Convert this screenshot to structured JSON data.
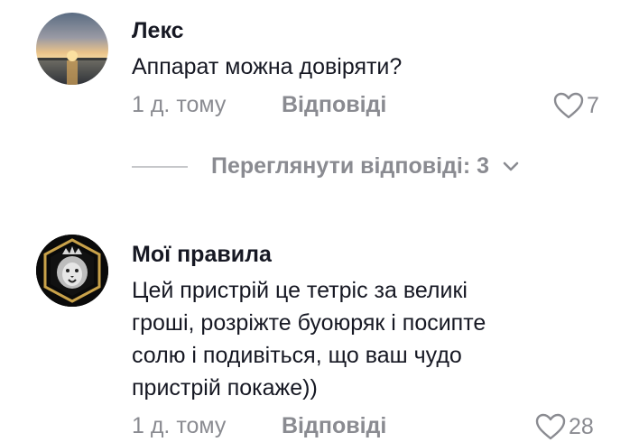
{
  "comments": [
    {
      "author": "Лекс",
      "text": "Аппарат можна довіряти?",
      "time": "1 д. тому",
      "reply_label": "Відповіді",
      "likes": "7"
    },
    {
      "author": "Мої правила",
      "text_lines": [
        "Цей пристрій це тетріс за великі",
        "гроші, розріжте буоюряк і посипте",
        "солю і подивіться, що ваш чудо",
        "пристрій покаже))"
      ],
      "time": "1 д. тому",
      "reply_label": "Відповіді",
      "likes": "28"
    }
  ],
  "view_replies": "Переглянути відповіді: 3",
  "icons": {
    "like": "heart-outline-icon",
    "expand": "chevron-down-icon"
  },
  "colors": {
    "text": "#161823",
    "muted": "#8a8b91"
  }
}
